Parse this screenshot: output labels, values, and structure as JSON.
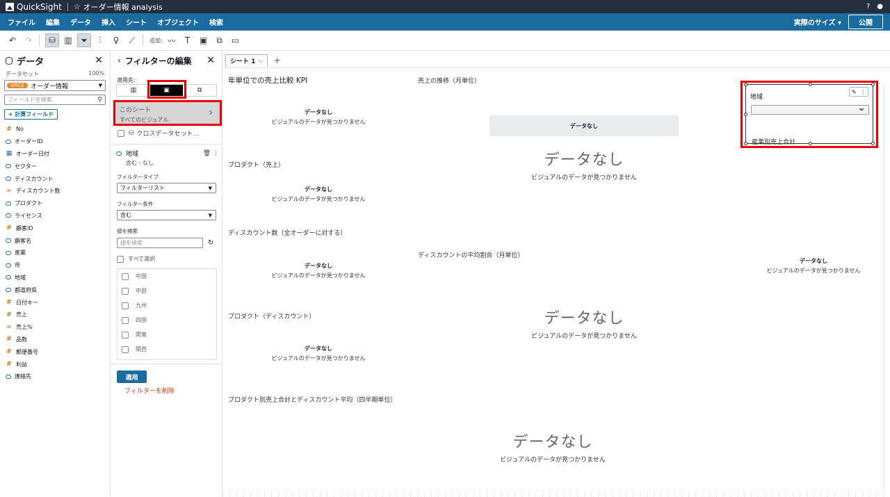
{
  "app": {
    "name": "QuickSight",
    "title": "オーダー情報 analysis"
  },
  "menu": {
    "items": [
      "ファイル",
      "編集",
      "データ",
      "挿入",
      "シート",
      "オブジェクト",
      "検索"
    ],
    "size_label": "実際のサイズ",
    "publish_label": "公開"
  },
  "toolbar": {
    "add_label": "追加:"
  },
  "data_panel": {
    "title": "データ",
    "dataset_label": "データセット",
    "dataset_pct": "100%",
    "spice_label": "SPICE",
    "dataset_name": "オーダー情報",
    "field_search_placeholder": "フィールドを検索",
    "calc_field_label": "+ 計算フィールド",
    "fields": [
      {
        "name": "No",
        "type": "num"
      },
      {
        "name": "オーダーID",
        "type": "str"
      },
      {
        "name": "オーダー日付",
        "type": "date"
      },
      {
        "name": "セクター",
        "type": "str"
      },
      {
        "name": "ディスカウント",
        "type": "str"
      },
      {
        "name": "ディスカウント数",
        "type": "num2"
      },
      {
        "name": "プロダクト",
        "type": "str"
      },
      {
        "name": "ライセンス",
        "type": "str"
      },
      {
        "name": "顧客ID",
        "type": "num"
      },
      {
        "name": "顧客名",
        "type": "str"
      },
      {
        "name": "産業",
        "type": "str"
      },
      {
        "name": "市",
        "type": "str"
      },
      {
        "name": "地域",
        "type": "str"
      },
      {
        "name": "都道府県",
        "type": "str"
      },
      {
        "name": "日付キー",
        "type": "num"
      },
      {
        "name": "売上",
        "type": "num"
      },
      {
        "name": "売上%",
        "type": "num2"
      },
      {
        "name": "品数",
        "type": "num"
      },
      {
        "name": "郵便番号",
        "type": "num"
      },
      {
        "name": "利益",
        "type": "num"
      },
      {
        "name": "連絡先",
        "type": "str"
      }
    ]
  },
  "filter_panel": {
    "title": "フィルターの編集",
    "apply_to_label": "適用先:",
    "sheet_option": "このシート",
    "sheet_option_sub": "すべてのビジュアル",
    "cross_dataset": "クロスデータセット…",
    "filter_field": "地域",
    "filter_summary": "含む - なし",
    "filter_type_label": "フィルタータイプ",
    "filter_type_value": "フィルターリスト",
    "filter_cond_label": "フィルター条件",
    "filter_cond_value": "含む",
    "search_values_label": "値を検索",
    "search_values_placeholder": "値を検索",
    "select_all": "すべて選択",
    "values": [
      "中国",
      "中部",
      "九州",
      "四国",
      "関東",
      "関西"
    ],
    "apply_label": "適用",
    "delete_label": "フィルターを削除"
  },
  "sheet": {
    "tab_label": "シート 1",
    "visuals": {
      "kpi_title": "年単位での売上比較 KPI",
      "trend_title": "売上の推移（月単位）",
      "product_sales_title": "プロダクト（売上）",
      "discount_count_title": "ディスカウント数（全オーダーに対する）",
      "discount_avg_title": "ディスカウントの平均割合（月単位）",
      "product_discount_title": "プロダクト（ディスカウント）",
      "industry_title": "産業別売上合計",
      "quarter_title": "プロダクト別売上合計とディスカウント平均（四半期単位）"
    },
    "nodata": "データなし",
    "nodata_desc": "ビジュアルのデータが見つかりません",
    "control_title": "地域"
  }
}
